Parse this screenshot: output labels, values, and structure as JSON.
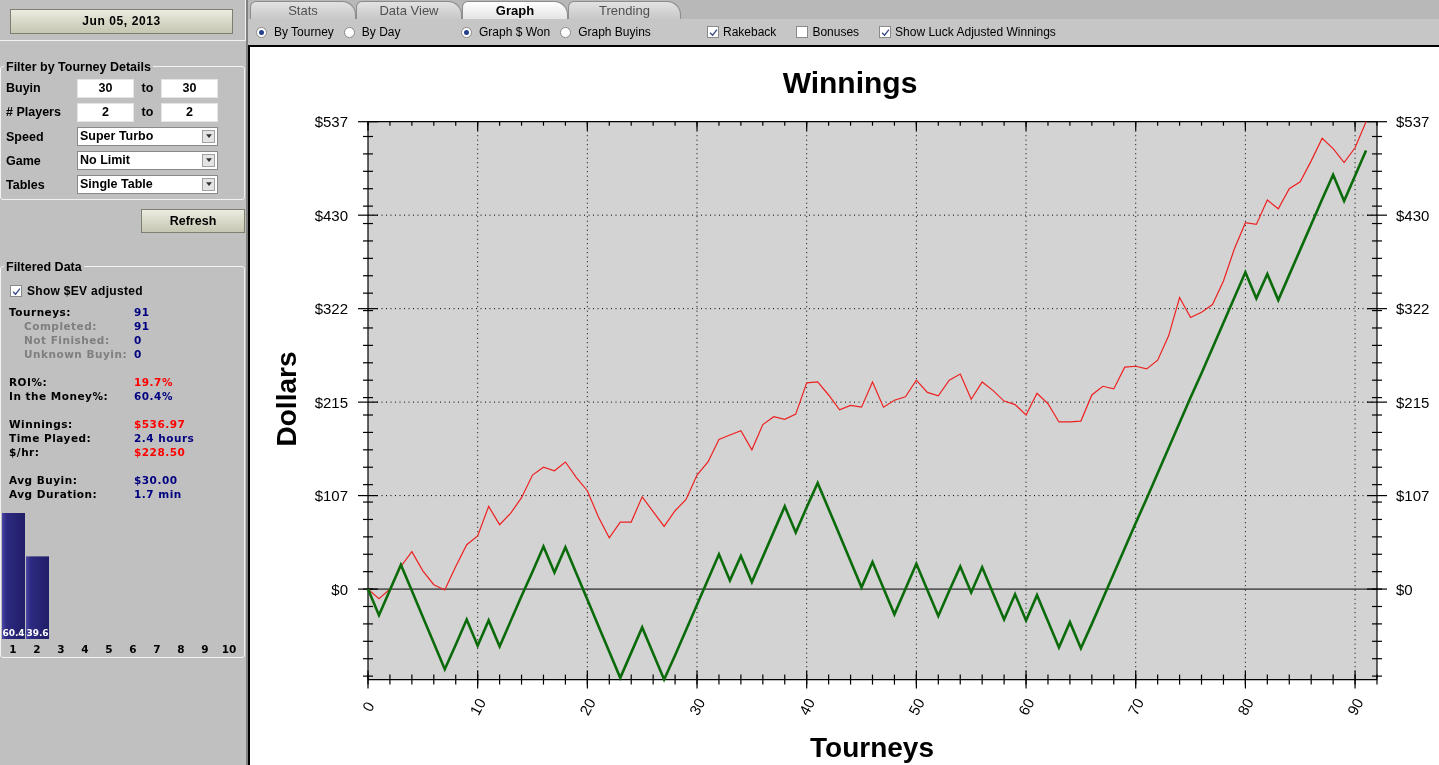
{
  "date_button": "Jun 05, 2013",
  "filter": {
    "title": "Filter by Tourney Details",
    "ranges": [
      {
        "label": "Buyin",
        "from": "30",
        "separator": "to",
        "to": "30"
      },
      {
        "label": "# Players",
        "from": "2",
        "separator": "to",
        "to": "2"
      }
    ],
    "dropdowns": [
      {
        "label": "Speed",
        "value": "Super Turbo"
      },
      {
        "label": "Game",
        "value": "No Limit"
      },
      {
        "label": "Tables",
        "value": "Single Table"
      }
    ]
  },
  "refresh_button": "Refresh",
  "filtered_data": {
    "title": "Filtered Data",
    "show_ev": {
      "label": "Show $EV adjusted",
      "checked": true
    },
    "stat_groups": [
      [
        {
          "label": "Tourneys:",
          "value": "91",
          "color": "#000080",
          "children": [
            {
              "label": "Completed:",
              "value": "91",
              "color": "#000080"
            },
            {
              "label": "Not Finished:",
              "value": "0",
              "color": "#000080"
            },
            {
              "label": "Unknown Buyin:",
              "value": "0",
              "color": "#000080"
            }
          ]
        }
      ],
      [
        {
          "label": "ROI%:",
          "value": "19.7%",
          "color": "#ff0000"
        },
        {
          "label": "In the Money%:",
          "value": "60.4%",
          "color": "#000080"
        }
      ],
      [
        {
          "label": "Winnings:",
          "value": "$536.97",
          "color": "#ff0000"
        },
        {
          "label": "Time Played:",
          "value": "2.4 hours",
          "color": "#000080"
        },
        {
          "label": "$/hr:",
          "value": "$228.50",
          "color": "#ff0000"
        }
      ],
      [
        {
          "label": "Avg Buyin:",
          "value": "$30.00",
          "color": "#000080"
        },
        {
          "label": "Avg Duration:",
          "value": "1.7 min",
          "color": "#000080"
        }
      ]
    ],
    "finish_chart": {
      "chart_data": {
        "type": "bar",
        "categories": [
          "1",
          "2",
          "3",
          "4",
          "5",
          "6",
          "7",
          "8",
          "9",
          "10"
        ],
        "values": [
          60.4,
          39.6,
          0,
          0,
          0,
          0,
          0,
          0,
          0,
          0
        ],
        "value_labels": [
          "60.4",
          "39.6",
          null,
          null,
          null,
          null,
          null,
          null,
          null,
          null
        ]
      }
    }
  },
  "tabs": [
    {
      "label": "Stats",
      "selected": false
    },
    {
      "label": "Data View",
      "selected": false
    },
    {
      "label": "Graph",
      "selected": true
    },
    {
      "label": "Trending",
      "selected": false
    }
  ],
  "toolbar": {
    "range_options": [
      {
        "label": "By Tourney",
        "selected": true
      },
      {
        "label": "By Day",
        "selected": false
      }
    ],
    "graph_options": [
      {
        "label": "Graph $ Won",
        "selected": true
      },
      {
        "label": "Graph Buyins",
        "selected": false
      }
    ],
    "checkboxes": [
      {
        "label": "Rakeback",
        "checked": true
      },
      {
        "label": "Bonuses",
        "checked": false
      },
      {
        "label": "Show Luck Adjusted Winnings",
        "checked": true
      }
    ]
  },
  "graph": {
    "chart_data": {
      "type": "line",
      "title": "Winnings",
      "xlabel": "Tourneys",
      "ylabel": "Dollars",
      "x": [
        0,
        1,
        2,
        3,
        4,
        5,
        6,
        7,
        8,
        9,
        10,
        11,
        12,
        13,
        14,
        15,
        16,
        17,
        18,
        19,
        20,
        21,
        22,
        23,
        24,
        25,
        26,
        27,
        28,
        29,
        30,
        31,
        32,
        33,
        34,
        35,
        36,
        37,
        38,
        39,
        40,
        41,
        42,
        43,
        44,
        45,
        46,
        47,
        48,
        49,
        50,
        51,
        52,
        53,
        54,
        55,
        56,
        57,
        58,
        59,
        60,
        61,
        62,
        63,
        64,
        65,
        66,
        67,
        68,
        69,
        70,
        71,
        72,
        73,
        74,
        75,
        76,
        77,
        78,
        79,
        80,
        81,
        82,
        83,
        84,
        85,
        86,
        87,
        88,
        89,
        90,
        91
      ],
      "series": [
        {
          "color": "#ee2020",
          "values": [
            0,
            -11,
            0,
            26,
            43,
            21,
            5,
            -1,
            26,
            51,
            61,
            95,
            74,
            87,
            105,
            131,
            140,
            136,
            146,
            128,
            113,
            83,
            59,
            77,
            77,
            106,
            89,
            72,
            90,
            103,
            131,
            146,
            172,
            177,
            182,
            160,
            189,
            198,
            195,
            201,
            237,
            238,
            223,
            206,
            211,
            209,
            238,
            209,
            217,
            221,
            240,
            226,
            222,
            240,
            247,
            218,
            238,
            228,
            216,
            212,
            200,
            225,
            213,
            192,
            192,
            193,
            223,
            233,
            230,
            255,
            256,
            253,
            263,
            291,
            335,
            312,
            318,
            327,
            354,
            391,
            421,
            419,
            447,
            437,
            460,
            468,
            492,
            518,
            506,
            490,
            507,
            537
          ]
        },
        {
          "color": "#0b6b0b",
          "values": [
            0,
            -30,
            -1,
            28,
            -2,
            -32,
            -62,
            -92,
            -64,
            -35,
            -65,
            -36,
            -66,
            -37,
            -8,
            20,
            49,
            19,
            48,
            18,
            -12,
            -42,
            -72,
            -102,
            -73,
            -44,
            -74,
            -104,
            -76,
            -47,
            -18,
            11,
            40,
            10,
            38,
            8,
            37,
            66,
            95,
            65,
            94,
            122,
            92,
            62,
            32,
            2,
            31,
            1,
            -29,
            0,
            29,
            -1,
            -31,
            -2,
            26,
            -4,
            25,
            -5,
            -35,
            -6,
            -36,
            -7,
            -37,
            -67,
            -38,
            -68,
            -40,
            -11,
            18,
            47,
            76,
            104,
            133,
            162,
            191,
            220,
            248,
            277,
            306,
            335,
            364,
            334,
            362,
            332,
            361,
            390,
            419,
            448,
            476,
            446,
            475,
            504
          ]
        }
      ],
      "xlim": [
        0,
        92
      ],
      "ylim": [
        -104,
        537
      ],
      "xticks": [
        0,
        10,
        20,
        30,
        40,
        50,
        60,
        70,
        80,
        90
      ],
      "yticks": [
        {
          "value": 537,
          "label": "$537"
        },
        {
          "value": 429.6,
          "label": "$430"
        },
        {
          "value": 322.2,
          "label": "$322"
        },
        {
          "value": 214.8,
          "label": "$215"
        },
        {
          "value": 107.4,
          "label": "$107"
        },
        {
          "value": 0,
          "label": "$0"
        }
      ],
      "grid": true
    },
    "right_axis_labels": [
      "$537",
      "$430",
      "$322",
      "$215",
      "$107",
      "$0"
    ]
  }
}
